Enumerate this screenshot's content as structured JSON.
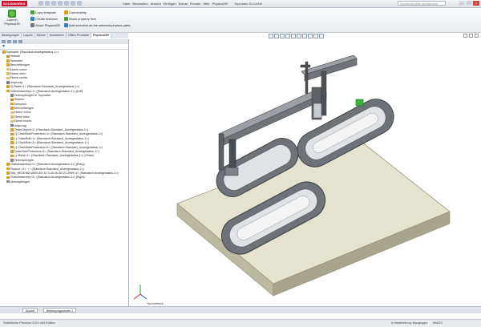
{
  "app": {
    "logo": "SOLIDWORKS",
    "document_title": "Toploader.SLDASM",
    "menus": [
      "Datei",
      "Bearbeiten",
      "Ansicht",
      "Einfügen",
      "Extras",
      "Fenster",
      "Hilfe",
      "PhysicsDR"
    ],
    "search_placeholder": "SolidWorks-Hilfe durchsuchen"
  },
  "ribbon": {
    "launch_label": "Launch PhysicsDR",
    "commands": [
      {
        "label": "Copy template",
        "color": "#4a9c3c"
      },
      {
        "label": "Create instance",
        "color": "#3a78c2"
      },
      {
        "label": "About PhysicsDR",
        "color": "#777777"
      },
      {
        "label": "Connectivity",
        "color": "#d9a020"
      },
      {
        "label": "Show property tree",
        "color": "#4a9c3c"
      },
      {
        "label": "Add selection as the selected physics parts",
        "color": "#3a78c2"
      }
    ]
  },
  "tabs": [
    {
      "label": "Bewegungen",
      "active": false
    },
    {
      "label": "Layout",
      "active": false
    },
    {
      "label": "Skizze",
      "active": false
    },
    {
      "label": "Auswerten",
      "active": false
    },
    {
      "label": "Office-Produkte",
      "active": false
    },
    {
      "label": "PhysicsDR",
      "active": true
    }
  ],
  "tree": [
    {
      "text": "Toploader (Standard<Anzeigestatus-1>)",
      "indent": 0,
      "icon": "#d9a020"
    },
    {
      "text": "Historie",
      "indent": 1,
      "icon": "#c98a2a"
    },
    {
      "text": "Sensoren",
      "indent": 1,
      "icon": "#d9a020"
    },
    {
      "text": "Beschriftungen",
      "indent": 1,
      "icon": "#d9a020"
    },
    {
      "text": "Ebene vorne",
      "indent": 1,
      "icon": "#d9c070"
    },
    {
      "text": "Ebene oben",
      "indent": 1,
      "icon": "#d9c070"
    },
    {
      "text": "Ebene rechts",
      "indent": 1,
      "icon": "#d9c070"
    },
    {
      "text": "Ursprung",
      "indent": 1,
      "icon": "#7a7a7a"
    },
    {
      "text": "(f) Platte<1> (Standard<Standard_Anzeigestatus-1>)",
      "indent": 1,
      "icon": "#c9a227"
    },
    {
      "text": "ChainAssembly<1> (Standard<Anzeigestatus-1>) (Left)",
      "indent": 1,
      "icon": "#c9a227"
    },
    {
      "text": "Verknüpfungen in Toploader",
      "indent": 2,
      "icon": "#8a8a8a"
    },
    {
      "text": "Historie",
      "indent": 2,
      "icon": "#c98a2a"
    },
    {
      "text": "Sensoren",
      "indent": 2,
      "icon": "#d9a020"
    },
    {
      "text": "Beschriftungen",
      "indent": 2,
      "icon": "#d9a020"
    },
    {
      "text": "Ebene vorne",
      "indent": 2,
      "icon": "#d9c070"
    },
    {
      "text": "Ebene oben",
      "indent": 2,
      "icon": "#d9c070"
    },
    {
      "text": "Ebene rechts",
      "indent": 2,
      "icon": "#d9c070"
    },
    {
      "text": "Ursprung",
      "indent": 2,
      "icon": "#7a7a7a"
    },
    {
      "text": "ChainObject<1> (Standard<Standard_Anzeigestatus-1>)",
      "indent": 2,
      "icon": "#c9a227"
    },
    {
      "text": "(-) ChainSideProtection<1> (Standard<Standard_Anzeigestatus-1>)",
      "indent": 2,
      "icon": "#c9a227"
    },
    {
      "text": "(-) ChainRoll<1> (Standard<Standard_Anzeigestatus-1>)",
      "indent": 2,
      "icon": "#c9a227"
    },
    {
      "text": "(-) ChainRoll<2> (Standard<Standard_Anzeigestatus-1>)",
      "indent": 2,
      "icon": "#c9a227"
    },
    {
      "text": "(-) ChainSideProtection<2> (Standard<Standard_Anzeigestatus-1>)",
      "indent": 2,
      "icon": "#c9a227"
    },
    {
      "text": "ChainSideProtection<3> (Standard<Standard_Anzeigestatus-1>)",
      "indent": 2,
      "icon": "#c9a227"
    },
    {
      "text": "(-) Motor<1> (Standard<Standard_Anzeigestatus-1>) (Chain)",
      "indent": 2,
      "icon": "#c9a227"
    },
    {
      "text": "Verknüpfungen",
      "indent": 2,
      "icon": "#8a8a8a"
    },
    {
      "text": "ChainAssembly<2> (Standard<Anzeigestatus-1>) (Entry)",
      "indent": 1,
      "icon": "#c9a227"
    },
    {
      "text": "Product <2> ~ ^ (Standard<Standard_Anzeigestatus-1>)",
      "indent": 1,
      "icon": "#c9a227"
    },
    {
      "text": "SA6_BEGEMA VAKKUM 42 0-40-40-40-23-ZMH<1> (Standard<Anzeigestatus-1>)",
      "indent": 1,
      "icon": "#c9a227"
    },
    {
      "text": "ChainAssembly<3> (Standard<Anzeigestatus-1>) (Right)",
      "indent": 1,
      "icon": "#c9a227"
    },
    {
      "text": "Verknüpfungen",
      "indent": 1,
      "icon": "#8a8a8a"
    }
  ],
  "viewport": {
    "model_label": "*Isometrisch"
  },
  "bottom_tabs": [
    {
      "label": "Modell"
    },
    {
      "label": "Bewegungsstudie 1"
    }
  ],
  "status": {
    "left": "SolidWorks Premium 2010 x64 Edition",
    "middle": "In Bearbeitung: Baugruppe",
    "right": "MMGS"
  }
}
